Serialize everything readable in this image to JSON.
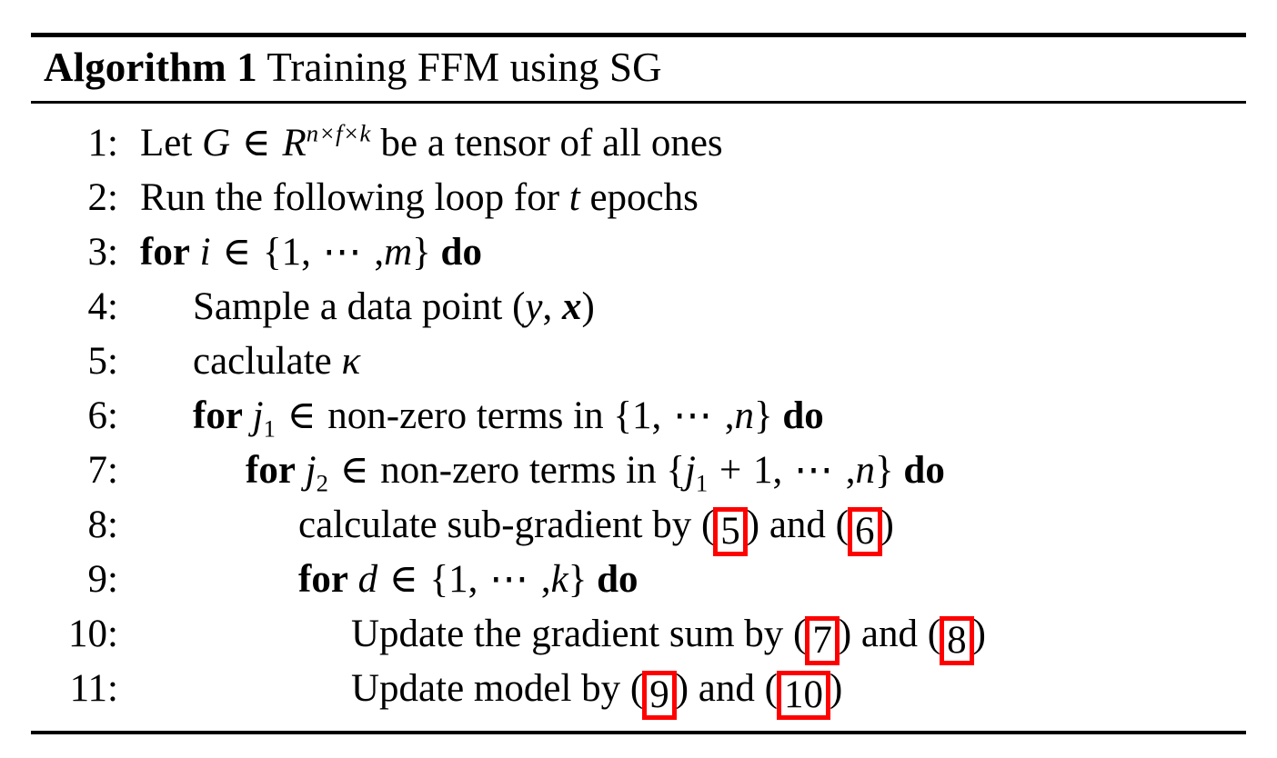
{
  "algorithm": {
    "caption": {
      "name": "Algorithm 1",
      "title": "Training FFM using SG"
    },
    "accent_color": "#fe0000",
    "text_color": "#000000",
    "background_color": "#ffffff",
    "steps": [
      {
        "number": "1:",
        "indent": 0,
        "plain_text": "Let G ∈ R^{n×f×k} be a tensor of all ones",
        "parts": [
          {
            "t": "text",
            "v": "Let "
          },
          {
            "t": "mi",
            "v": "G"
          },
          {
            "t": "op",
            "v": " ∈ "
          },
          {
            "t": "mi",
            "v": "R"
          },
          {
            "t": "sup",
            "v": "n×f×k"
          },
          {
            "t": "text",
            "v": " be a tensor of all ones"
          }
        ]
      },
      {
        "number": "2:",
        "indent": 0,
        "plain_text": "Run the following loop for t epochs",
        "parts": [
          {
            "t": "text",
            "v": "Run the following loop for "
          },
          {
            "t": "mi",
            "v": "t"
          },
          {
            "t": "text",
            "v": " epochs"
          }
        ]
      },
      {
        "number": "3:",
        "indent": 0,
        "plain_text": "for i ∈ {1, ⋯ , m} do",
        "parts": [
          {
            "t": "kw",
            "v": "for"
          },
          {
            "t": "text",
            "v": " "
          },
          {
            "t": "mi",
            "v": "i"
          },
          {
            "t": "op",
            "v": " ∈ "
          },
          {
            "t": "mn",
            "v": "{1,"
          },
          {
            "t": "dots",
            "v": " ⋯ "
          },
          {
            "t": "mn",
            "v": ","
          },
          {
            "t": "mi",
            "v": "m"
          },
          {
            "t": "mn",
            "v": "}"
          },
          {
            "t": "text",
            "v": " "
          },
          {
            "t": "kw",
            "v": "do"
          }
        ]
      },
      {
        "number": "4:",
        "indent": 1,
        "plain_text": "Sample a data point (y, x)",
        "parts": [
          {
            "t": "text",
            "v": "Sample a data point "
          },
          {
            "t": "mn",
            "v": "("
          },
          {
            "t": "mi",
            "v": "y"
          },
          {
            "t": "mn",
            "v": ", "
          },
          {
            "t": "mbi",
            "v": "x"
          },
          {
            "t": "mn",
            "v": ")"
          }
        ]
      },
      {
        "number": "5:",
        "indent": 1,
        "plain_text": "caclulate κ",
        "parts": [
          {
            "t": "text",
            "v": "caclulate "
          },
          {
            "t": "mi",
            "v": "κ"
          }
        ]
      },
      {
        "number": "6:",
        "indent": 1,
        "plain_text": "for j1 ∈ non-zero terms in {1, ⋯ , n} do",
        "parts": [
          {
            "t": "kw",
            "v": "for"
          },
          {
            "t": "text",
            "v": " "
          },
          {
            "t": "mi",
            "v": "j"
          },
          {
            "t": "sub",
            "v": "1"
          },
          {
            "t": "op",
            "v": " ∈ "
          },
          {
            "t": "text",
            "v": " non-zero terms in "
          },
          {
            "t": "mn",
            "v": "{1,"
          },
          {
            "t": "dots",
            "v": " ⋯ "
          },
          {
            "t": "mn",
            "v": ","
          },
          {
            "t": "mi",
            "v": "n"
          },
          {
            "t": "mn",
            "v": "}"
          },
          {
            "t": "text",
            "v": " "
          },
          {
            "t": "kw",
            "v": "do"
          }
        ]
      },
      {
        "number": "7:",
        "indent": 2,
        "plain_text": "for j2 ∈ non-zero terms in {j1 + 1, ⋯ , n} do",
        "parts": [
          {
            "t": "kw",
            "v": "for"
          },
          {
            "t": "text",
            "v": " "
          },
          {
            "t": "mi",
            "v": "j"
          },
          {
            "t": "sub",
            "v": "2"
          },
          {
            "t": "op",
            "v": " ∈ "
          },
          {
            "t": "text",
            "v": " non-zero terms in "
          },
          {
            "t": "mn",
            "v": "{"
          },
          {
            "t": "mi",
            "v": "j"
          },
          {
            "t": "sub",
            "v": "1"
          },
          {
            "t": "op",
            "v": " + "
          },
          {
            "t": "mn",
            "v": "1,"
          },
          {
            "t": "dots",
            "v": " ⋯ "
          },
          {
            "t": "mn",
            "v": ","
          },
          {
            "t": "mi",
            "v": "n"
          },
          {
            "t": "mn",
            "v": "}"
          },
          {
            "t": "text",
            "v": " "
          },
          {
            "t": "kw",
            "v": "do"
          }
        ]
      },
      {
        "number": "8:",
        "indent": 3,
        "plain_text": "calculate sub-gradient by (5) and (6)",
        "parts": [
          {
            "t": "text",
            "v": "calculate sub-gradient by ("
          },
          {
            "t": "ref",
            "v": "5"
          },
          {
            "t": "text",
            "v": ") and ("
          },
          {
            "t": "ref",
            "v": "6"
          },
          {
            "t": "text",
            "v": ")"
          }
        ]
      },
      {
        "number": "9:",
        "indent": 3,
        "plain_text": "for d ∈ {1, ⋯ , k} do",
        "parts": [
          {
            "t": "kw",
            "v": "for"
          },
          {
            "t": "text",
            "v": " "
          },
          {
            "t": "mi",
            "v": "d"
          },
          {
            "t": "op",
            "v": " ∈ "
          },
          {
            "t": "mn",
            "v": "{1,"
          },
          {
            "t": "dots",
            "v": " ⋯ "
          },
          {
            "t": "mn",
            "v": ","
          },
          {
            "t": "mi",
            "v": "k"
          },
          {
            "t": "mn",
            "v": "}"
          },
          {
            "t": "text",
            "v": " "
          },
          {
            "t": "kw",
            "v": "do"
          }
        ]
      },
      {
        "number": "10:",
        "indent": 4,
        "plain_text": "Update the gradient sum by (7) and (8)",
        "parts": [
          {
            "t": "text",
            "v": "Update the gradient sum by ("
          },
          {
            "t": "ref",
            "v": "7"
          },
          {
            "t": "text",
            "v": ") and ("
          },
          {
            "t": "ref",
            "v": "8"
          },
          {
            "t": "text",
            "v": ")"
          }
        ]
      },
      {
        "number": "11:",
        "indent": 4,
        "plain_text": "Update model by (9) and (10)",
        "parts": [
          {
            "t": "text",
            "v": "Update model by ("
          },
          {
            "t": "ref",
            "v": "9"
          },
          {
            "t": "text",
            "v": ") and ("
          },
          {
            "t": "ref",
            "v": "10"
          },
          {
            "t": "text",
            "v": ")"
          }
        ]
      }
    ]
  }
}
